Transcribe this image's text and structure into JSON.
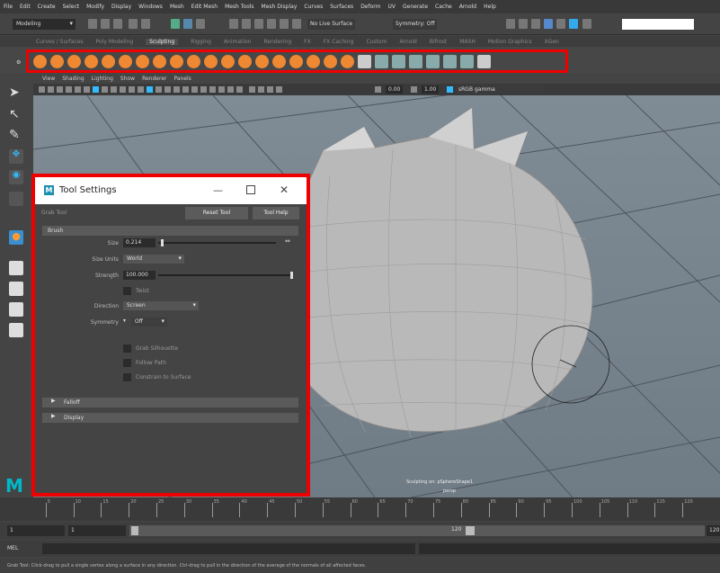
{
  "menubar": [
    "File",
    "Edit",
    "Create",
    "Select",
    "Modify",
    "Display",
    "Windows",
    "Mesh",
    "Edit Mesh",
    "Mesh Tools",
    "Mesh Display",
    "Curves",
    "Surfaces",
    "Deform",
    "UV",
    "Generate",
    "Cache",
    "Arnold",
    "Help"
  ],
  "statusline": {
    "mode": "Modeling",
    "live_surface": "No Live Surface",
    "symmetry": "Symmetry: Off"
  },
  "shelf_tabs": [
    "Curves / Surfaces",
    "Poly Modeling",
    "Sculpting",
    "Rigging",
    "Animation",
    "Rendering",
    "FX",
    "FX Caching",
    "Custom",
    "Arnold",
    "Bifrost",
    "MASH",
    "Motion Graphics",
    "XGen"
  ],
  "shelf_active_tab": "Sculpting",
  "viewport": {
    "menu": [
      "View",
      "Shading",
      "Lighting",
      "Show",
      "Renderer",
      "Panels"
    ],
    "exposure": "0.00",
    "gamma": "1.00",
    "colorspace": "sRGB gamma",
    "hud_sculpt": "Sculpting on: pSphereShape1",
    "camera": "persp"
  },
  "tool_settings": {
    "title": "Tool Settings",
    "tool_name": "Grab Tool",
    "reset_label": "Reset Tool",
    "help_label": "Tool Help",
    "brush_section": "Brush",
    "size_label": "Size",
    "size_value": "0.214",
    "size_fraction": 0.02,
    "size_units_label": "Size Units",
    "size_units_value": "World",
    "strength_label": "Strength",
    "strength_value": "100.000",
    "strength_fraction": 1.0,
    "twist_label": "Twist",
    "direction_label": "Direction",
    "direction_value": "Screen",
    "symmetry_label": "Symmetry",
    "symmetry_value": "Off",
    "grab_silhouette": "Grab Silhouette",
    "follow_path": "Follow Path",
    "constrain": "Constrain to Surface",
    "falloff_section": "Falloff",
    "display_section": "Display"
  },
  "timeline": {
    "ticks": [
      "5",
      "10",
      "15",
      "20",
      "25",
      "30",
      "35",
      "40",
      "45",
      "50",
      "55",
      "60",
      "65",
      "70",
      "75",
      "80",
      "85",
      "90",
      "95",
      "100",
      "105",
      "110",
      "115",
      "120"
    ]
  },
  "range": {
    "start": "1",
    "inner_start": "1",
    "inner_end": "120",
    "end": "120"
  },
  "cmdline": {
    "label": "MEL"
  },
  "helpline": "Grab Tool: Click-drag to pull a single vertex along a surface in any direction. Ctrl-drag to pull in the direction of the average of the normals of all affected faces.",
  "colors": {
    "highlight": "#e00000",
    "maya_logo": "#00b9c8",
    "shelf_icon": "#ee8833"
  }
}
